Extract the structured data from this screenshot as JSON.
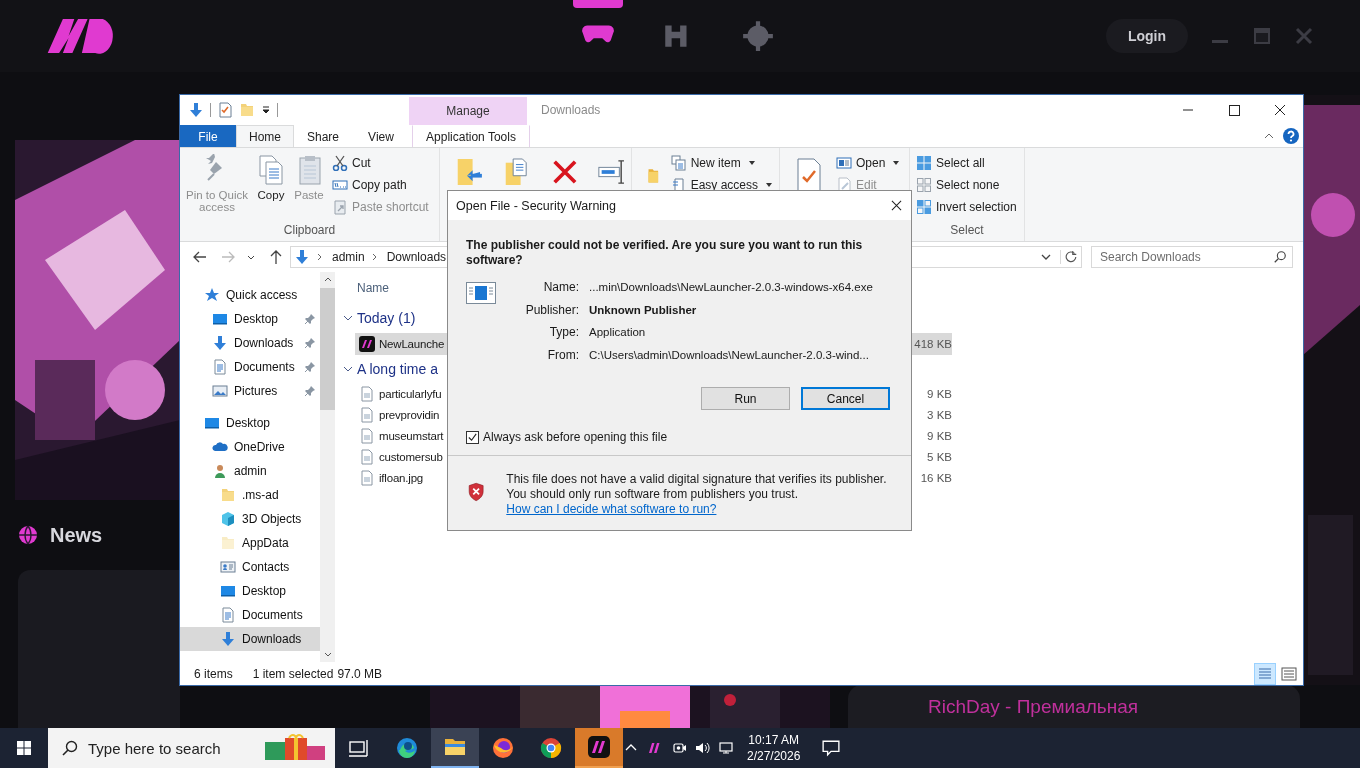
{
  "launcher": {
    "nav": [
      {
        "kind": "gamepad",
        "selected": true
      },
      {
        "kind": "hammer",
        "selected": false
      },
      {
        "kind": "settings",
        "selected": false
      }
    ],
    "login": "Login",
    "news": "News",
    "promo": "RichDay - Премиальная"
  },
  "explorer": {
    "title": "Downloads",
    "context_group": "Manage",
    "tabs": [
      {
        "label": "File",
        "kind": "file",
        "selected": false
      },
      {
        "label": "Home",
        "kind": "tab",
        "selected": true
      },
      {
        "label": "Share",
        "kind": "tab",
        "selected": false
      },
      {
        "label": "View",
        "kind": "tab",
        "selected": false
      },
      {
        "label": "Application Tools",
        "kind": "context",
        "selected": false
      }
    ],
    "ribbon": {
      "clipboard": {
        "label": "Clipboard",
        "large": [
          {
            "label": "Pin to Quick access",
            "kind": "pin",
            "disabled": true
          },
          {
            "label": "Copy",
            "kind": "copy",
            "disabled": false
          },
          {
            "label": "Paste",
            "kind": "paste",
            "disabled": true
          }
        ],
        "small": [
          {
            "label": "Cut",
            "kind": "cut",
            "disabled": false
          },
          {
            "label": "Copy path",
            "kind": "copy-path",
            "disabled": false
          },
          {
            "label": "Paste shortcut",
            "kind": "shortcut",
            "disabled": true
          }
        ]
      },
      "new": [
        {
          "label": "New item",
          "kind": "new-item"
        },
        {
          "label": "Easy access",
          "kind": "easy-access"
        }
      ],
      "open": [
        {
          "label": "Open",
          "kind": "open",
          "disabled": false
        },
        {
          "label": "Edit",
          "kind": "edit",
          "disabled": true
        }
      ],
      "select": {
        "label": "Select",
        "items": [
          {
            "label": "Select all",
            "kind": "all"
          },
          {
            "label": "Select none",
            "kind": "none"
          },
          {
            "label": "Invert selection",
            "kind": "invert"
          }
        ]
      }
    },
    "address": {
      "path": [
        "admin",
        "Downloads"
      ]
    },
    "search": {
      "placeholder": "Search Downloads"
    },
    "quick_access": {
      "label": "Quick access",
      "items": [
        {
          "label": "Desktop",
          "kind": "desktop",
          "pinned": true
        },
        {
          "label": "Downloads",
          "kind": "download",
          "pinned": true
        },
        {
          "label": "Documents",
          "kind": "documents",
          "pinned": true
        },
        {
          "label": "Pictures",
          "kind": "pictures",
          "pinned": true
        }
      ]
    },
    "tree": [
      {
        "label": "Desktop",
        "kind": "desktop",
        "selected": false,
        "children": [
          {
            "label": "OneDrive",
            "kind": "cloud",
            "selected": false
          },
          {
            "label": "admin",
            "kind": "user",
            "selected": false,
            "children": [
              {
                "label": ".ms-ad",
                "kind": "folder",
                "selected": false
              },
              {
                "label": "3D Objects",
                "kind": "cube",
                "selected": false
              },
              {
                "label": "AppData",
                "kind": "folder-pale",
                "selected": false
              },
              {
                "label": "Contacts",
                "kind": "contacts",
                "selected": false
              },
              {
                "label": "Desktop",
                "kind": "desktop",
                "selected": false
              },
              {
                "label": "Documents",
                "kind": "documents",
                "selected": false
              },
              {
                "label": "Downloads",
                "kind": "download",
                "selected": true
              }
            ]
          }
        ]
      }
    ],
    "list": {
      "column": "Name",
      "groups": [
        {
          "label": "Today (1)",
          "expanded": true,
          "files": [
            {
              "name": "NewLaunche",
              "kind": "app",
              "size": "418 KB",
              "selected": true
            }
          ]
        },
        {
          "label": "A long time a",
          "expanded": true,
          "files": [
            {
              "name": "particularlyfu",
              "kind": "file",
              "size": "9 KB",
              "selected": false
            },
            {
              "name": "prevprovidin",
              "kind": "file",
              "size": "3 KB",
              "selected": false
            },
            {
              "name": "museumstart",
              "kind": "file",
              "size": "9 KB",
              "selected": false
            },
            {
              "name": "customersub",
              "kind": "file",
              "size": "5 KB",
              "selected": false
            },
            {
              "name": "ifloan.jpg",
              "kind": "file",
              "size": "16 KB",
              "selected": false
            }
          ]
        }
      ]
    },
    "status": {
      "count": "6 items",
      "selection": "1 item selected",
      "size": "97.0 MB"
    }
  },
  "dialog": {
    "title": "Open File - Security Warning",
    "heading": "The publisher could not be verified. Are you sure you want to run this software?",
    "fields": [
      {
        "label": "Name:",
        "value": "...min\\Downloads\\NewLauncher-2.0.3-windows-x64.exe",
        "bold": false
      },
      {
        "label": "Publisher:",
        "value": "Unknown Publisher",
        "bold": true
      },
      {
        "label": "Type:",
        "value": "Application",
        "bold": false
      },
      {
        "label": "From:",
        "value": "C:\\Users\\admin\\Downloads\\NewLauncher-2.0.3-wind...",
        "bold": false
      }
    ],
    "buttons": [
      {
        "label": "Run",
        "focused": false
      },
      {
        "label": "Cancel",
        "focused": true
      }
    ],
    "checkbox": {
      "label": "Always ask before opening this file",
      "checked": true
    },
    "warning": "This file does not have a valid digital signature that verifies its publisher. You should only run software from publishers you trust.",
    "link": "How can I decide what software to run?"
  },
  "taskbar": {
    "search_placeholder": "Type here to search",
    "apps": [
      {
        "kind": "task-view",
        "active": false,
        "flashing": false
      },
      {
        "kind": "edge",
        "active": false,
        "flashing": false
      },
      {
        "kind": "explorer",
        "active": true,
        "flashing": false
      },
      {
        "kind": "firefox",
        "active": false,
        "flashing": false
      },
      {
        "kind": "chrome",
        "active": false,
        "flashing": false
      },
      {
        "kind": "launcher",
        "active": false,
        "flashing": true
      }
    ],
    "time": "10:17 AM",
    "date": "2/27/2026"
  }
}
